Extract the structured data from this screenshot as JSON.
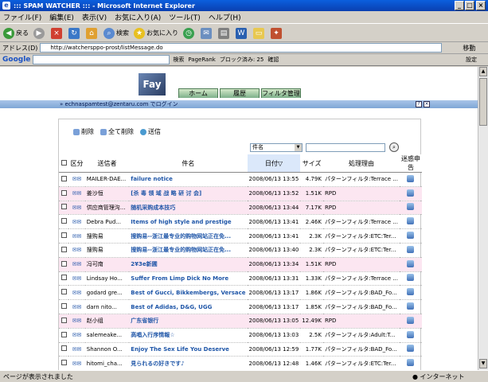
{
  "window": {
    "title": "::: SPAM WATCHER ::: - Microsoft Internet Explorer"
  },
  "menu": [
    "ファイル(F)",
    "編集(E)",
    "表示(V)",
    "お気に入り(A)",
    "ツール(T)",
    "ヘルプ(H)"
  ],
  "toolbar": {
    "back": "戻る",
    "search": "検索",
    "favorites": "お気に入り"
  },
  "address": {
    "label": "アドレス(D)",
    "url": "http://watchersppo-prost/listMessage.do",
    "go": "移動"
  },
  "google": {
    "logo": "Google",
    "search_btn": "検索",
    "pagerank": "PageRank",
    "blocked": "ブロック済み: 25",
    "check": "確認",
    "settings": "設定"
  },
  "nav": {
    "logo": "Fay",
    "tabs": [
      "ホーム",
      "履歴",
      "フィルタ管理"
    ]
  },
  "user": {
    "text": "» echnaspamtest@zentaru.com でログイン"
  },
  "actions": {
    "delete": "削除",
    "delete_all": "全て削除",
    "send": "送信"
  },
  "filter": {
    "field_selected": "件名",
    "search_value": ""
  },
  "table": {
    "columns": [
      "区分",
      "送信者",
      "件名",
      "日付▽",
      "サイズ",
      "処理理由",
      "迷惑申告"
    ],
    "rows": [
      {
        "sender": "MAILER-DAE...",
        "subject": "failure notice",
        "date": "2008/06/13 13:55",
        "size": "4.79K",
        "reason": "パターンフィルタ:Terrace ...",
        "pink": false
      },
      {
        "sender": "姜沙恒",
        "subject": "[杀 毒 领 域 战 略 研 讨 会]",
        "date": "2008/06/13 13:52",
        "size": "1.51K",
        "reason": "RPD",
        "pink": true
      },
      {
        "sender": "供应商管理沟...",
        "subject": "随机采购成本技巧",
        "date": "2008/06/13 13:44",
        "size": "7.17K",
        "reason": "RPD",
        "pink": true
      },
      {
        "sender": "Debra Pud...",
        "subject": "Items of high style and prestige",
        "date": "2008/06/13 13:41",
        "size": "2.46K",
        "reason": "パターンフィルタ:Terrace ...",
        "pink": false
      },
      {
        "sender": "搜购易",
        "subject": "搜购易--浙江最专业的购物网站正在免...",
        "date": "2008/06/13 13:41",
        "size": "2.3K",
        "reason": "パターンフィルタ:ETC:Ter...",
        "pink": false
      },
      {
        "sender": "搜购易",
        "subject": "搜购易--浙江最专业的购物网站正在免...",
        "date": "2008/06/13 13:40",
        "size": "2.3K",
        "reason": "パターンフィルタ:ETC:Ter...",
        "pink": false
      },
      {
        "sender": "冯可南",
        "subject": "2¥3e新圃",
        "date": "2008/06/13 13:34",
        "size": "1.51K",
        "reason": "RPD",
        "pink": true
      },
      {
        "sender": "Lindsay Ho...",
        "subject": "Suffer From Limp Dick No More",
        "date": "2008/06/13 13:31",
        "size": "1.33K",
        "reason": "パターンフィルタ:Terrace ...",
        "pink": false
      },
      {
        "sender": "godard gre...",
        "subject": "Best of Gucci, Bikkembergs, Versace",
        "date": "2008/06/13 13:17",
        "size": "1.86K",
        "reason": "パターンフィルタ:BAD_Fo...",
        "pink": false
      },
      {
        "sender": "darn nito...",
        "subject": "Best of Adidas, D&G, UGG",
        "date": "2008/06/13 13:17",
        "size": "1.85K",
        "reason": "パターンフィルタ:BAD_Fo...",
        "pink": false
      },
      {
        "sender": "赵小组",
        "subject": "广东省银行",
        "date": "2008/06/13 13:05",
        "size": "12.49K",
        "reason": "RPD",
        "pink": true
      },
      {
        "sender": "salemeake...",
        "subject": "高唱入行序情報☆",
        "date": "2008/06/13 13:03",
        "size": "2.5K",
        "reason": "パターンフィルタ:Adult:T...",
        "pink": false
      },
      {
        "sender": "Shannon O...",
        "subject": "Enjoy The Sex Life You Deserve",
        "date": "2008/06/13 12:59",
        "size": "1.77K",
        "reason": "パターンフィルタ:BAD_Fo...",
        "pink": false
      },
      {
        "sender": "hitomi_cha...",
        "subject": "見られるの好きです♪",
        "date": "2008/06/13 12:48",
        "size": "1.46K",
        "reason": "パターンフィルタ:ETC:Ter...",
        "pink": false
      }
    ]
  },
  "status": {
    "text": "ページが表示されました",
    "zone": "インターネット"
  }
}
